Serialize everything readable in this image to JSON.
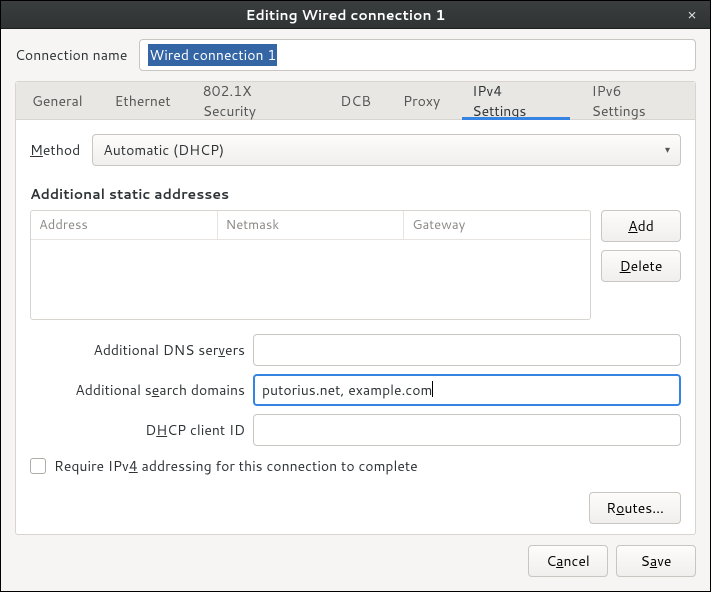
{
  "titlebar": {
    "title": "Editing Wired connection 1"
  },
  "connection_name": {
    "label": "Connection name",
    "value": "Wired connection 1"
  },
  "tabs": {
    "general": "General",
    "ethernet": "Ethernet",
    "security": "802.1X Security",
    "dcb": "DCB",
    "proxy": "Proxy",
    "ipv4": "IPv4 Settings",
    "ipv6": "IPv6 Settings"
  },
  "ipv4": {
    "method_prefix": "M",
    "method_suffix": "ethod",
    "method_value": "Automatic (DHCP)",
    "section_header": "Additional static addresses",
    "col_address": "Address",
    "col_netmask": "Netmask",
    "col_gateway": "Gateway",
    "add_prefix": "A",
    "add_suffix": "dd",
    "delete_prefix": "D",
    "delete_suffix": "elete",
    "dns_prefix": "Additional DNS ser",
    "dns_underline": "v",
    "dns_suffix": "ers",
    "dns_value": "",
    "search_prefix": "Additional s",
    "search_underline": "e",
    "search_suffix": "arch domains",
    "search_value": "putorius.net, example.com",
    "dhcp_prefix": "D",
    "dhcp_underline": "H",
    "dhcp_suffix": "CP client ID",
    "dhcp_value": "",
    "require_prefix": "Require IPv",
    "require_underline": "4",
    "require_suffix": " addressing for this connection to complete",
    "routes_prefix": "R",
    "routes_underline": "o",
    "routes_suffix": "utes…"
  },
  "footer": {
    "cancel_prefix": "C",
    "cancel_underline": "a",
    "cancel_suffix": "ncel",
    "save_prefix": "S",
    "save_underline": "a",
    "save_suffix": "ve"
  }
}
